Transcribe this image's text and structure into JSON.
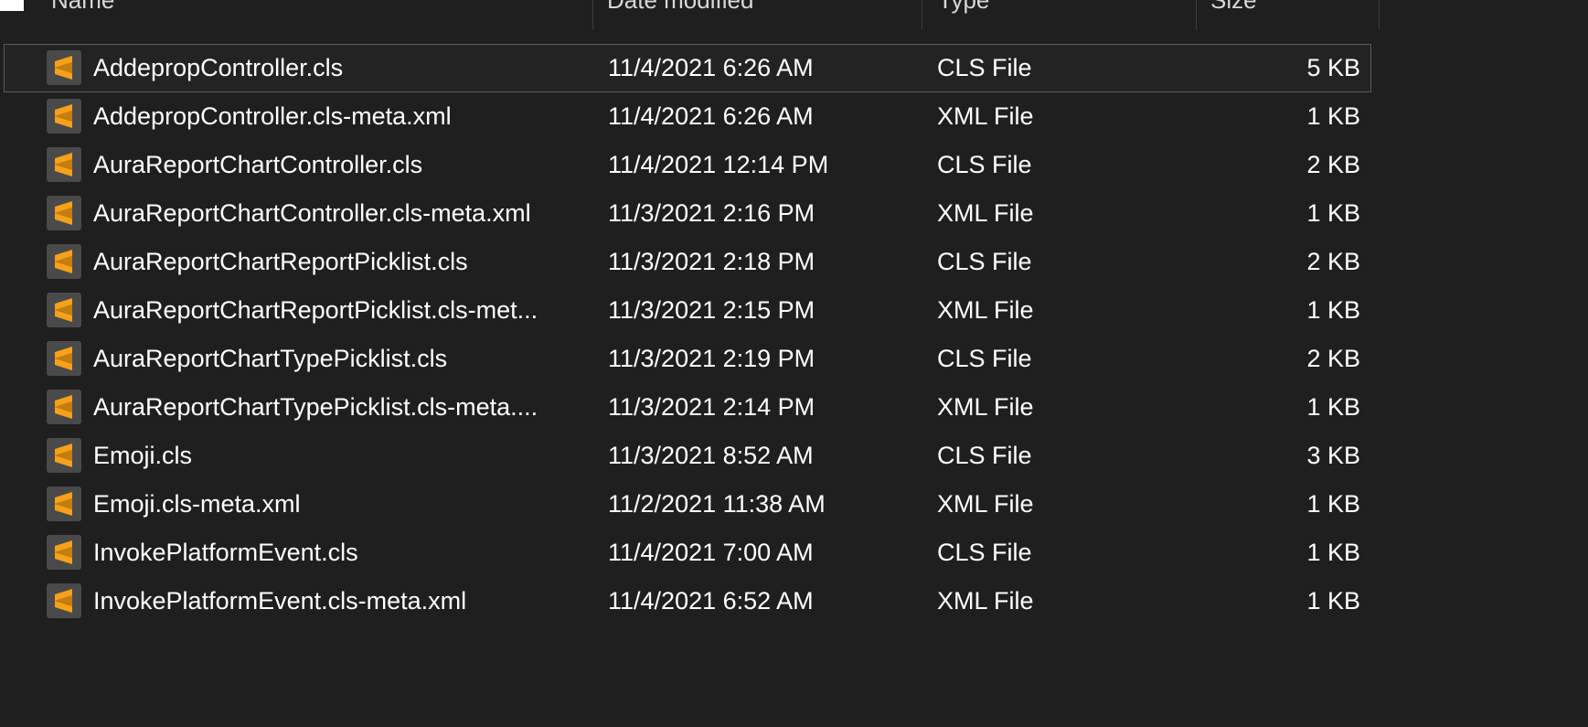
{
  "columns": {
    "name": "Name",
    "date_modified": "Date modified",
    "type": "Type",
    "size": "Size"
  },
  "colors": {
    "background": "#1f1f1f",
    "icon_tile": "#4a4a4a",
    "icon_glyph": "#f7a11a",
    "selection_border": "#5c5c5c"
  },
  "icon_name": "sublime-text-file-icon",
  "files": [
    {
      "name": "AddepropController.cls",
      "date": "11/4/2021 6:26 AM",
      "type": "CLS File",
      "size": "5 KB",
      "selected": true
    },
    {
      "name": "AddepropController.cls-meta.xml",
      "date": "11/4/2021 6:26 AM",
      "type": "XML File",
      "size": "1 KB"
    },
    {
      "name": "AuraReportChartController.cls",
      "date": "11/4/2021 12:14 PM",
      "type": "CLS File",
      "size": "2 KB"
    },
    {
      "name": "AuraReportChartController.cls-meta.xml",
      "date": "11/3/2021 2:16 PM",
      "type": "XML File",
      "size": "1 KB"
    },
    {
      "name": "AuraReportChartReportPicklist.cls",
      "date": "11/3/2021 2:18 PM",
      "type": "CLS File",
      "size": "2 KB"
    },
    {
      "name": "AuraReportChartReportPicklist.cls-met...",
      "date": "11/3/2021 2:15 PM",
      "type": "XML File",
      "size": "1 KB"
    },
    {
      "name": "AuraReportChartTypePicklist.cls",
      "date": "11/3/2021 2:19 PM",
      "type": "CLS File",
      "size": "2 KB"
    },
    {
      "name": "AuraReportChartTypePicklist.cls-meta....",
      "date": "11/3/2021 2:14 PM",
      "type": "XML File",
      "size": "1 KB"
    },
    {
      "name": "Emoji.cls",
      "date": "11/3/2021 8:52 AM",
      "type": "CLS File",
      "size": "3 KB"
    },
    {
      "name": "Emoji.cls-meta.xml",
      "date": "11/2/2021 11:38 AM",
      "type": "XML File",
      "size": "1 KB"
    },
    {
      "name": "InvokePlatformEvent.cls",
      "date": "11/4/2021 7:00 AM",
      "type": "CLS File",
      "size": "1 KB"
    },
    {
      "name": "InvokePlatformEvent.cls-meta.xml",
      "date": "11/4/2021 6:52 AM",
      "type": "XML File",
      "size": "1 KB"
    }
  ]
}
